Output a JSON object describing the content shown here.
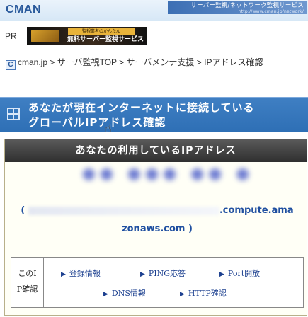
{
  "header": {
    "logo": "CMAN",
    "banner_title": "サーバー監視/ネットワーク監視サービス",
    "banner_url": "http://www.cman.jp/network/"
  },
  "pr": {
    "label": "PR",
    "ad_top": "監視業者のかんたん",
    "ad_text": "無料サーバー監視サービス"
  },
  "breadcrumb": {
    "icon": "C",
    "items": [
      "cman.jp",
      "サーバ監視TOP",
      "サーバメンテ支援",
      "IPアドレス確認"
    ],
    "separator": " > "
  },
  "cta": {
    "line1": "あなたが現在インターネットに接続している",
    "line2": "グローバルIPアドレス確認"
  },
  "panel": {
    "title": "あなたの利用しているIPアドレス",
    "ip_blurred": "●● ●●● ●● ●",
    "host_open": "(",
    "host_suffix": ".compute.ama",
    "host_line2": "zonaws.com )"
  },
  "tools": {
    "label_line1": "このI",
    "label_line2": "P確認",
    "links": [
      "登録情報",
      "PING応答",
      "Port開放",
      "DNS情報",
      "HTTP確認"
    ]
  }
}
